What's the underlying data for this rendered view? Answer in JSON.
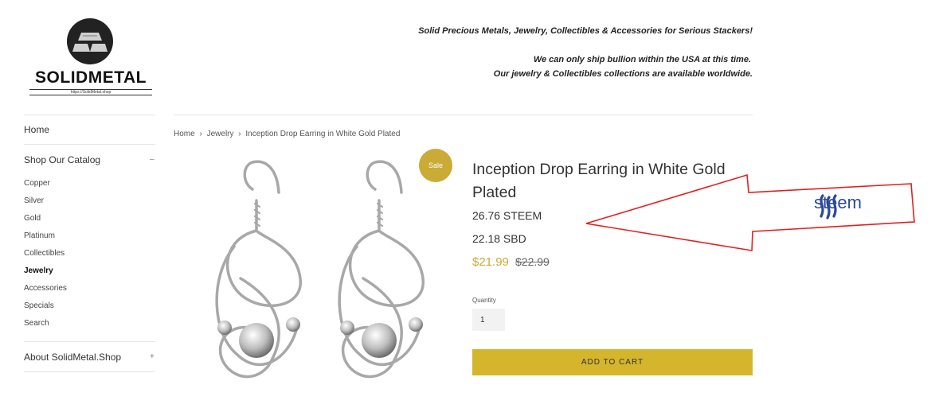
{
  "logo": {
    "wordmark": "SOLIDMETAL",
    "url": "https://SolidMetal.shop"
  },
  "header": {
    "tagline": "Solid Precious Metals, Jewelry, Collectibles & Accessories for Serious Stackers!",
    "shipping_line1": "We can only ship bullion within the USA at this time.",
    "shipping_line2": "Our jewelry & Collectibles collections are available worldwide."
  },
  "sidebar": {
    "home": "Home",
    "catalog": "Shop Our Catalog",
    "catalog_toggle": "–",
    "items": [
      "Copper",
      "Silver",
      "Gold",
      "Platinum",
      "Collectibles",
      "Jewelry",
      "Accessories",
      "Specials",
      "Search"
    ],
    "active_item": "Jewelry",
    "about": "About SolidMetal.Shop",
    "about_toggle": "+"
  },
  "breadcrumb": {
    "home": "Home",
    "sep": "›",
    "category": "Jewelry",
    "current": "Inception Drop Earring in White Gold Plated"
  },
  "product": {
    "sale_badge": "Sale",
    "title": "Inception Drop Earring in White Gold Plated",
    "price_steem": "26.76 STEEM",
    "price_sbd": "22.18 SBD",
    "price_sale": "$21.99",
    "price_original": "$22.99",
    "quantity_label": "Quantity",
    "quantity_value": "1",
    "add_to_cart": "ADD TO CART"
  },
  "annotation": {
    "logo_text": "steem"
  },
  "colors": {
    "accent_gold": "#c9ab36",
    "button_gold": "#d4b52c",
    "arrow_red": "#e02020",
    "steem_blue": "#2c4a9a"
  }
}
